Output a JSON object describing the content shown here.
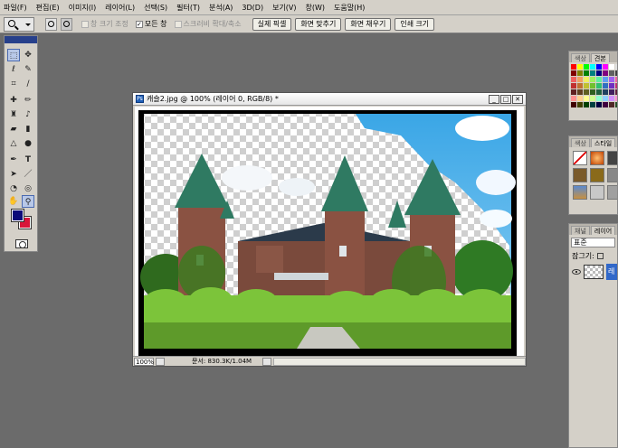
{
  "menu": [
    "파일(F)",
    "편집(E)",
    "이미지(I)",
    "레이어(L)",
    "선택(S)",
    "필터(T)",
    "분석(A)",
    "3D(D)",
    "보기(V)",
    "창(W)",
    "도움말(H)"
  ],
  "options": {
    "resize_windows": "창 크기 조정",
    "all_windows": "모든 창",
    "scrubby_zoom": "스크러비 확대/축소",
    "actual_pixels": "실제 픽셀",
    "fit_screen": "화면 맞추기",
    "fill_screen": "화면 채우기",
    "print_size": "인쇄 크기"
  },
  "document": {
    "title": "캐슬2.jpg @ 100% (레이어 0, RGB/8) *",
    "zoom": "100%",
    "doc_info": "문서: 830.3K/1.04M"
  },
  "panels": {
    "swatches_tabs": [
      "색상",
      "견본"
    ],
    "styles_tabs": [
      "색상",
      "스타일"
    ],
    "layers_tabs": [
      "채널",
      "레이어"
    ],
    "blend_mode": "표준",
    "lock_label": "잠그기:",
    "layer_name": "레"
  },
  "colors": {
    "foreground": "#0c0b7a",
    "background": "#d8163a",
    "selected_layer": "#3168c9"
  }
}
